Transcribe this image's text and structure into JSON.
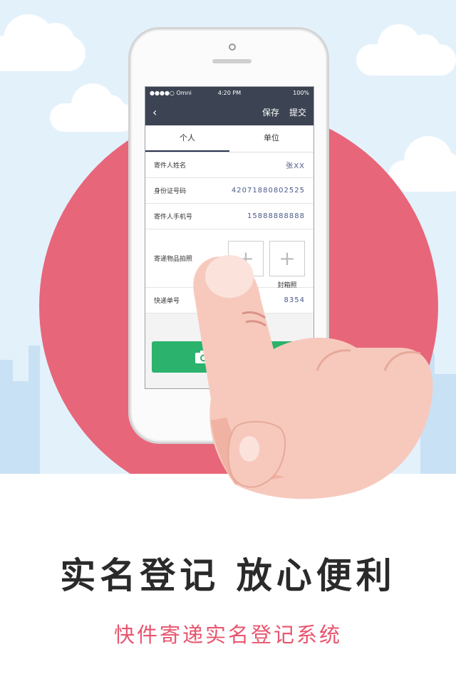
{
  "status_bar": {
    "carrier": "●●●●○ Omni",
    "time": "4:20 PM",
    "battery": "100%"
  },
  "nav": {
    "back_icon": "chevron-left",
    "save_label": "保存",
    "submit_label": "提交"
  },
  "tabs": [
    {
      "label": "个人",
      "active": true
    },
    {
      "label": "单位",
      "active": false
    }
  ],
  "form": {
    "sender_name_label": "寄件人姓名",
    "sender_name_value": "张XX",
    "id_number_label": "身份证号码",
    "id_number_value": "42071880802525",
    "phone_label": "寄件人手机号",
    "phone_value": "15888888888",
    "item_photo_label": "寄递物品拍照",
    "photo_add_icon": "plus",
    "seal_photo_caption": "封箱照",
    "tracking_label": "快递单号",
    "tracking_value_partial": "8354",
    "scan_icon": "camera"
  },
  "headline": "实名登记 放心便利",
  "subheadline": "快件寄递实名登记系统",
  "colors": {
    "sky": "#e3f1fb",
    "circle": "#e8667a",
    "navbar": "#3c4352",
    "button": "#2bb26c",
    "subheadline": "#e8556e"
  }
}
